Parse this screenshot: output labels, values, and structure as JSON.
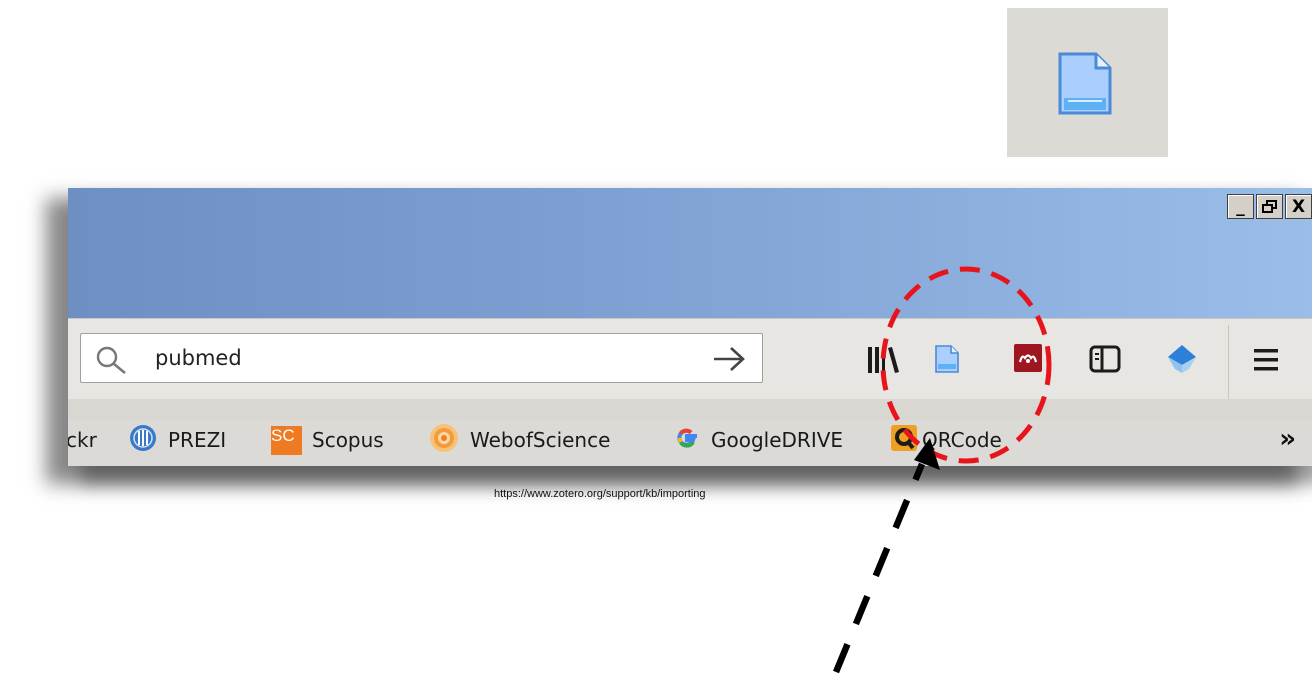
{
  "search": {
    "value": "pubmed"
  },
  "bookmarks": [
    {
      "label": "ckr",
      "icon": "flickr-icon"
    },
    {
      "label": "PREZI",
      "icon": "prezi-icon"
    },
    {
      "label": "Scopus",
      "icon": "scopus-icon",
      "badge": "SC"
    },
    {
      "label": "WebofScience",
      "icon": "webofscience-icon"
    },
    {
      "label": "GoogleDRIVE",
      "icon": "google-icon"
    },
    {
      "label": "QRCode",
      "icon": "qrcode-icon"
    }
  ],
  "overflow": {
    "symbol": "»"
  },
  "toolbar_icons": [
    "library-icon",
    "zotero-page-icon",
    "mendeley-icon",
    "sidebar-icon",
    "extension-icon",
    "menu-icon"
  ],
  "window_buttons": {
    "minimize": "_",
    "restore": "🗗",
    "close": "X"
  },
  "caption": "https://www.zotero.org/support/kb/importing",
  "colors": {
    "accent_highlight": "#e8141b",
    "scopus": "#ee7a22",
    "mendeley": "#9d1620",
    "titlebar": "#7c9ed1"
  }
}
